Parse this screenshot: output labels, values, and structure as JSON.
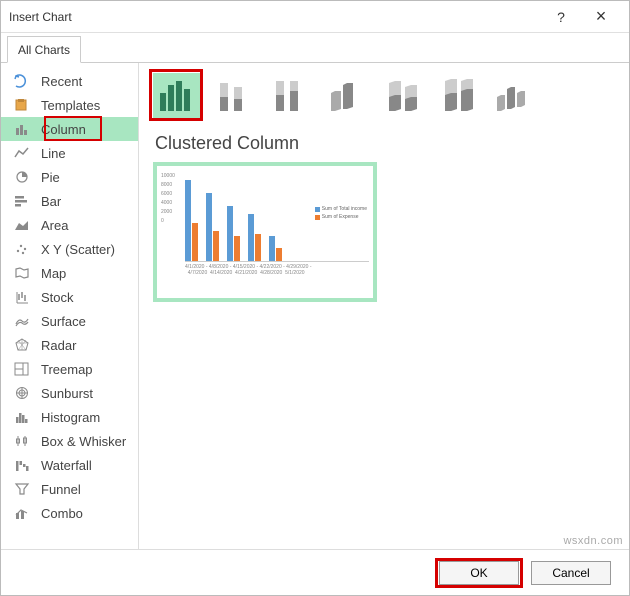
{
  "title": "Insert Chart",
  "titlebar": {
    "help": "?",
    "close": "×"
  },
  "tab": "All Charts",
  "sidebar": {
    "items": [
      {
        "label": "Recent",
        "icon": "recent-icon"
      },
      {
        "label": "Templates",
        "icon": "templates-icon"
      },
      {
        "label": "Column",
        "icon": "column-icon",
        "selected": true
      },
      {
        "label": "Line",
        "icon": "line-icon"
      },
      {
        "label": "Pie",
        "icon": "pie-icon"
      },
      {
        "label": "Bar",
        "icon": "bar-icon"
      },
      {
        "label": "Area",
        "icon": "area-icon"
      },
      {
        "label": "X Y (Scatter)",
        "icon": "scatter-icon"
      },
      {
        "label": "Map",
        "icon": "map-icon"
      },
      {
        "label": "Stock",
        "icon": "stock-icon"
      },
      {
        "label": "Surface",
        "icon": "surface-icon"
      },
      {
        "label": "Radar",
        "icon": "radar-icon"
      },
      {
        "label": "Treemap",
        "icon": "treemap-icon"
      },
      {
        "label": "Sunburst",
        "icon": "sunburst-icon"
      },
      {
        "label": "Histogram",
        "icon": "histogram-icon"
      },
      {
        "label": "Box & Whisker",
        "icon": "boxwhisker-icon"
      },
      {
        "label": "Waterfall",
        "icon": "waterfall-icon"
      },
      {
        "label": "Funnel",
        "icon": "funnel-icon"
      },
      {
        "label": "Combo",
        "icon": "combo-icon"
      }
    ]
  },
  "subtypes": [
    {
      "name": "clustered-column",
      "selected": true
    },
    {
      "name": "stacked-column"
    },
    {
      "name": "100-stacked-column"
    },
    {
      "name": "3d-clustered-column"
    },
    {
      "name": "3d-stacked-column"
    },
    {
      "name": "3d-100-stacked-column"
    },
    {
      "name": "3d-column"
    }
  ],
  "preview_title": "Clustered Column",
  "buttons": {
    "ok": "OK",
    "cancel": "Cancel"
  },
  "watermark": "wsxdn.com",
  "chart_data": {
    "type": "bar",
    "categories": [
      "4/1/2020 - 4/7/2020",
      "4/8/2020 - 4/14/2020",
      "4/15/2020 - 4/21/2020",
      "4/22/2020 - 4/28/2020",
      "4/29/2020 - 5/1/2020"
    ],
    "series": [
      {
        "name": "Sum of Total income",
        "values": [
          9500,
          8000,
          6500,
          5500,
          3000
        ],
        "color": "#5b9bd5"
      },
      {
        "name": "Sum of Expense",
        "values": [
          4500,
          3500,
          3000,
          3200,
          1500
        ],
        "color": "#ed7d31"
      }
    ],
    "ylim": [
      0,
      10000
    ],
    "title": "",
    "xlabel": "",
    "ylabel": ""
  }
}
